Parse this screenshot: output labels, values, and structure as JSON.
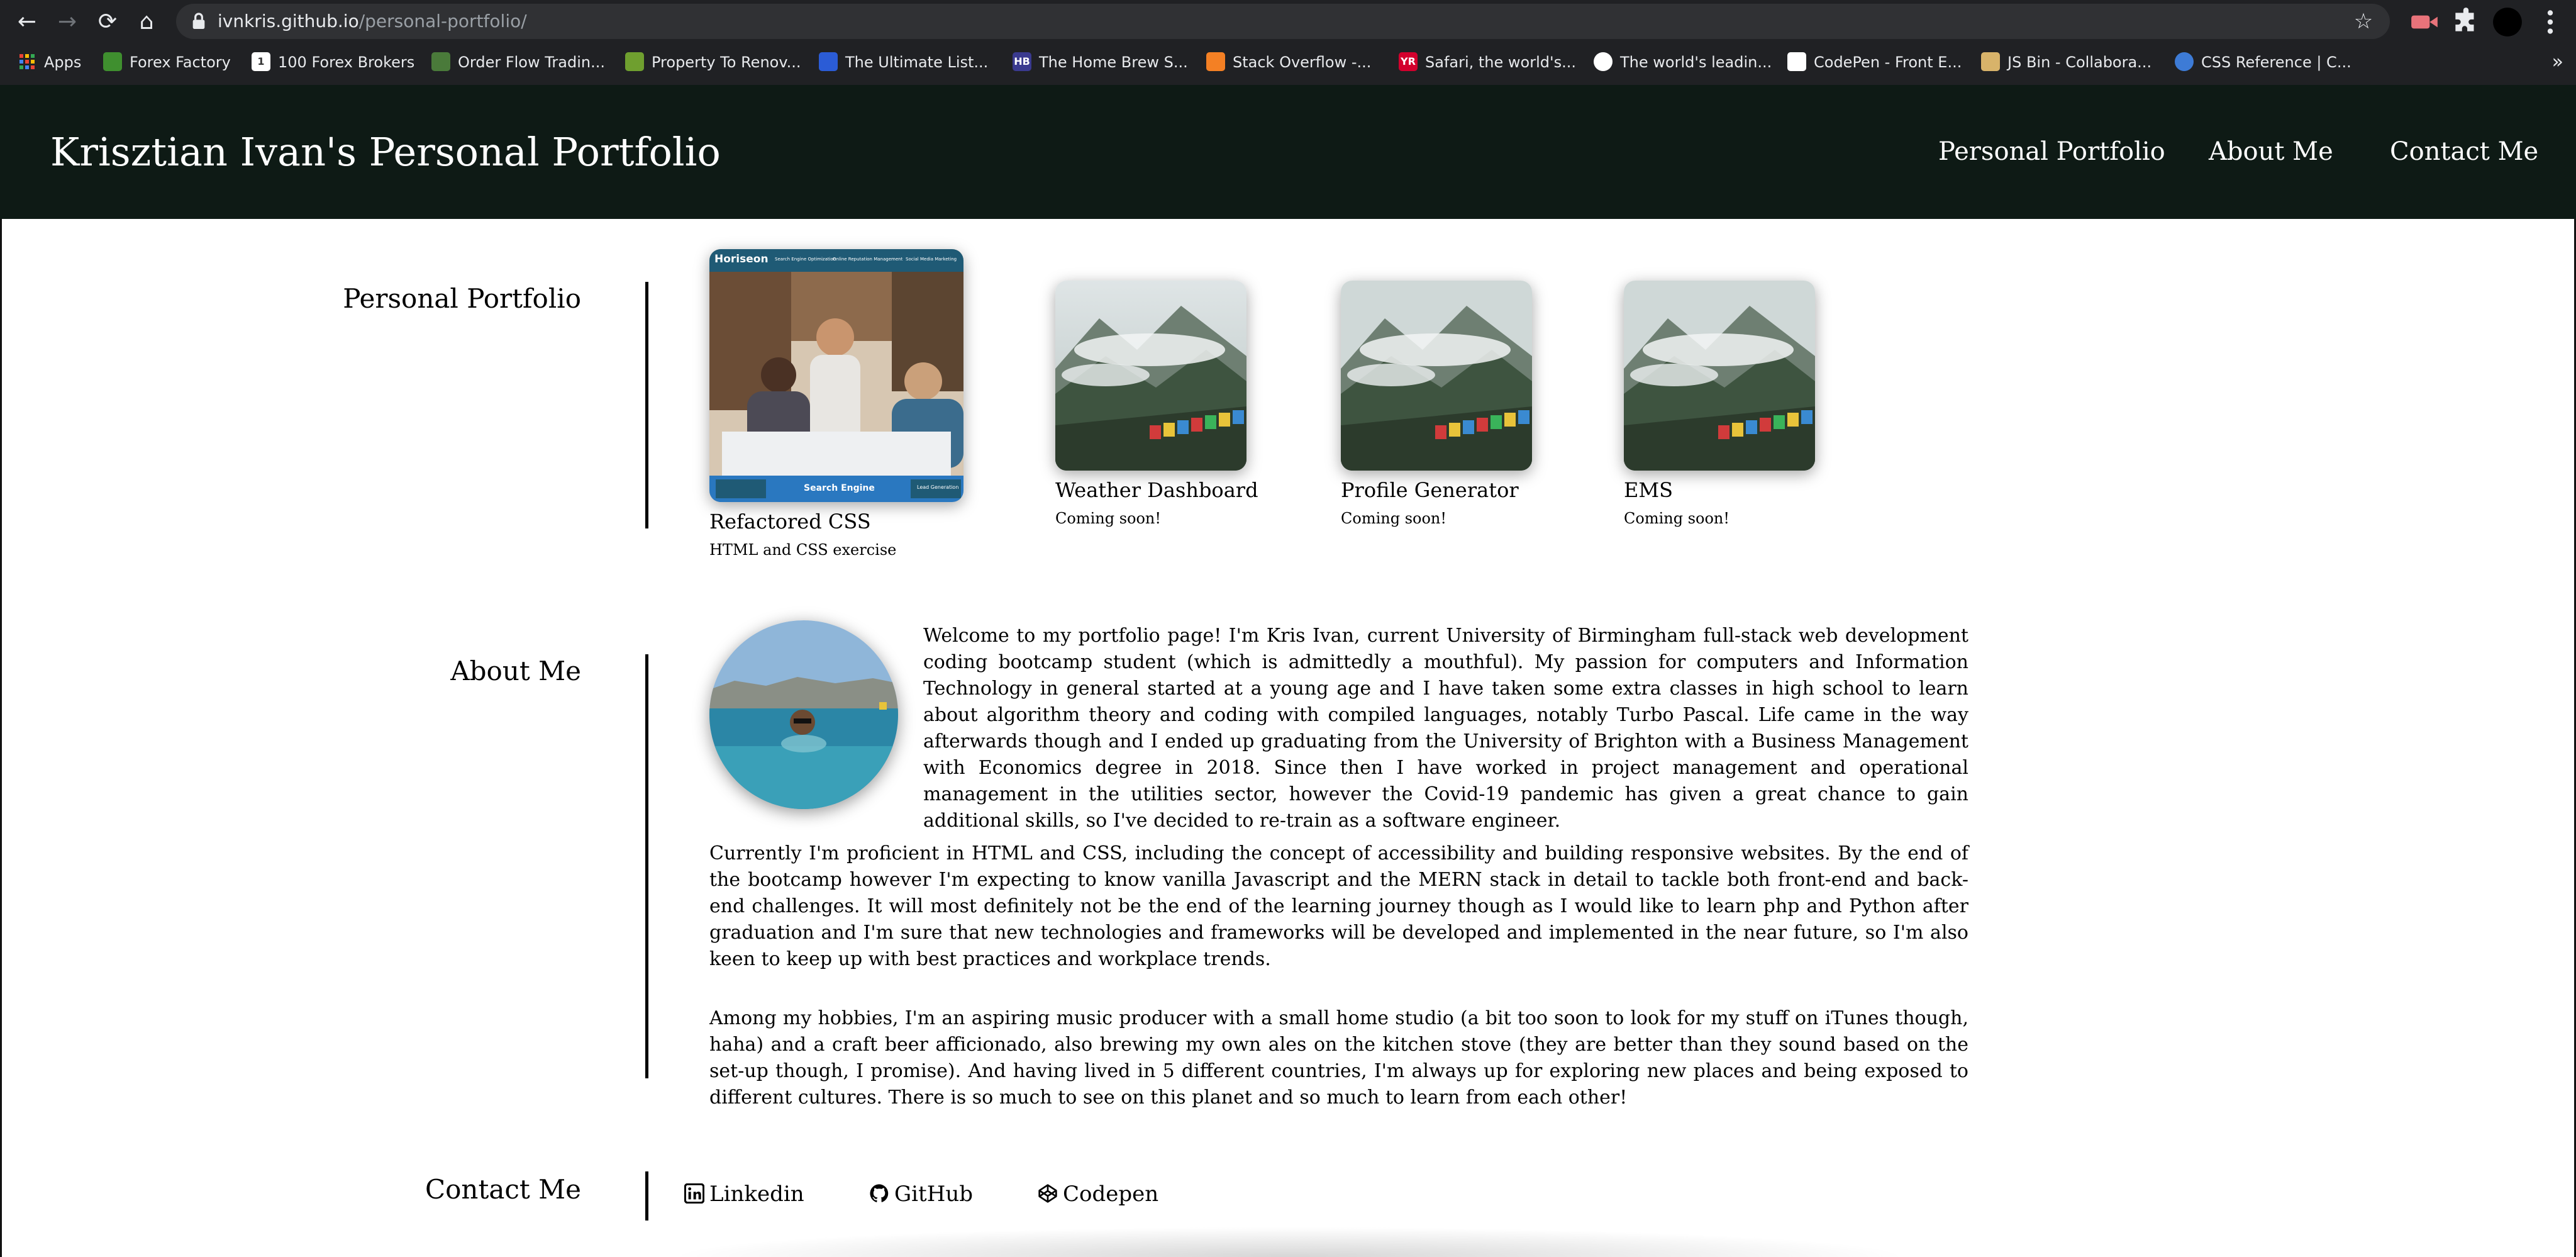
{
  "browser": {
    "url_host": "ivnkris.github.io",
    "url_path": "/personal-portfolio/",
    "bookmarks": [
      {
        "label": "Apps",
        "icon": "apps-grid-icon",
        "color": "#ea4335"
      },
      {
        "label": "Forex Factory",
        "icon": "forex-factory-icon",
        "color": "#3f8f2f"
      },
      {
        "label": "100 Forex Brokers",
        "icon": "forex-brokers-icon",
        "color": "#ffffff"
      },
      {
        "label": "Order Flow Tradin...",
        "icon": "order-flow-icon",
        "color": "#4a7a3a"
      },
      {
        "label": "Property To Renov...",
        "icon": "property-icon",
        "color": "#6f9f2f"
      },
      {
        "label": "The Ultimate List...",
        "icon": "ultimate-list-icon",
        "color": "#2b5cd6"
      },
      {
        "label": "The Home Brew S...",
        "icon": "home-brew-icon",
        "color": "#3a3a8f",
        "text": "HB"
      },
      {
        "label": "Stack Overflow -...",
        "icon": "stack-overflow-icon",
        "color": "#f48024"
      },
      {
        "label": "Safari, the world's...",
        "icon": "safari-books-icon",
        "color": "#d3002d",
        "text": "YR"
      },
      {
        "label": "The world's leadin...",
        "icon": "github-icon",
        "color": "#ffffff"
      },
      {
        "label": "CodePen - Front E...",
        "icon": "codepen-icon",
        "color": "#ffffff"
      },
      {
        "label": "JS Bin - Collabora...",
        "icon": "jsbin-icon",
        "color": "#d8b36a"
      },
      {
        "label": "CSS Reference | C...",
        "icon": "css-reference-icon",
        "color": "#3d7bd6"
      }
    ],
    "more_label": "»"
  },
  "header": {
    "title": "Krisztian Ivan's Personal Portfolio",
    "nav": [
      "Personal Portfolio",
      "About Me",
      "Contact Me"
    ]
  },
  "portfolio": {
    "heading": "Personal Portfolio",
    "featured": {
      "title": "Refactored CSS",
      "subtitle": "HTML and CSS exercise",
      "thumb_brand": "Horiseon",
      "thumb_nav": [
        "Search Engine Optimization",
        "Online Reputation Management",
        "Social Media Marketing"
      ],
      "thumb_footer": "Search Engine",
      "thumb_footer_right": "Lead Generation"
    },
    "projects": [
      {
        "title": "Weather Dashboard",
        "subtitle": "Coming soon!"
      },
      {
        "title": "Profile Generator",
        "subtitle": "Coming soon!"
      },
      {
        "title": "EMS",
        "subtitle": "Coming soon!"
      }
    ]
  },
  "about": {
    "heading": "About Me",
    "paragraphs": [
      "Welcome to my portfolio page! I'm Kris Ivan, current University of Birmingham full-stack web development coding bootcamp student (which is admittedly a mouthful). My passion for computers and Information Technology in general started at a young age and I have taken some extra classes in high school to learn about algorithm theory and coding with compiled languages, notably Turbo Pascal. Life came in the way afterwards though and I ended up graduating from the University of Brighton with a Business Management with Economics degree in 2018. Since then I have worked in project management and operational management in the utilities sector, however the Covid-19 pandemic has given a great chance to gain additional skills, so I've decided to re-train as a software engineer.",
      "Currently I'm proficient in HTML and CSS, including the concept of accessibility and building responsive websites. By the end of the bootcamp however I'm expecting to know vanilla Javascript and the MERN stack in detail to tackle both front-end and back-end challenges. It will most definitely not be the end of the learning journey though as I would like to learn php and Python after graduation and I'm sure that new technologies and frameworks will be developed and implemented in the near future, so I'm also keen to keep up with best practices and workplace trends.",
      "Among my hobbies, I'm an aspiring music producer with a small home studio (a bit too soon to look for my stuff on iTunes though, haha) and a craft beer afficionado, also brewing my own ales on the kitchen stove (they are better than they sound based on the set-up though, I promise). And having lived in 5 different countries, I'm always up for exploring new places and being exposed to different cultures. There is so much to see on this planet and so much to learn from each other!"
    ]
  },
  "contact": {
    "heading": "Contact Me",
    "links": [
      {
        "label": "Linkedin",
        "icon": "linkedin-icon"
      },
      {
        "label": "GitHub",
        "icon": "github-icon"
      },
      {
        "label": "Codepen",
        "icon": "codepen-icon"
      }
    ]
  },
  "colors": {
    "header_bg": "#0e1a15",
    "browser_bg": "#202124",
    "text": "#000000"
  }
}
